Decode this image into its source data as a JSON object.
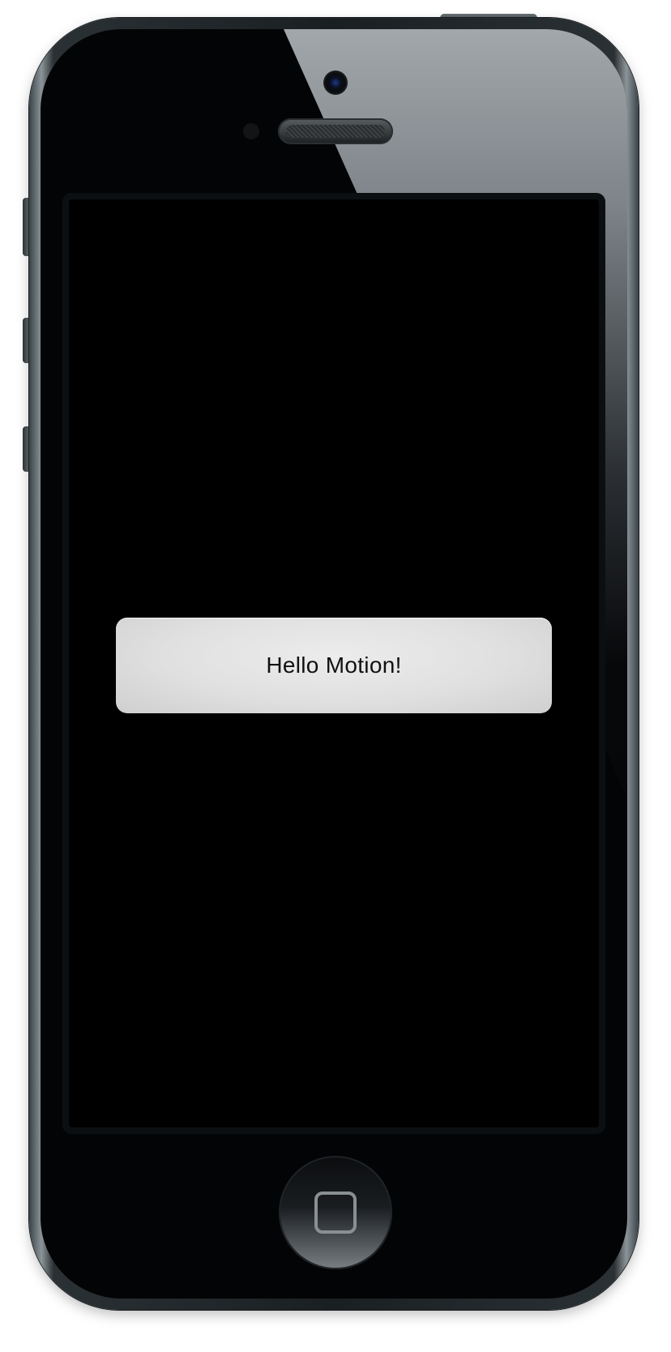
{
  "device": {
    "frame": "iPhone",
    "screen_background": "#000000"
  },
  "screen": {
    "button": {
      "label": "Hello Motion!"
    }
  },
  "icons": {
    "camera": "front-camera-icon",
    "speaker": "earpiece-speaker-icon",
    "home": "home-button-icon"
  }
}
